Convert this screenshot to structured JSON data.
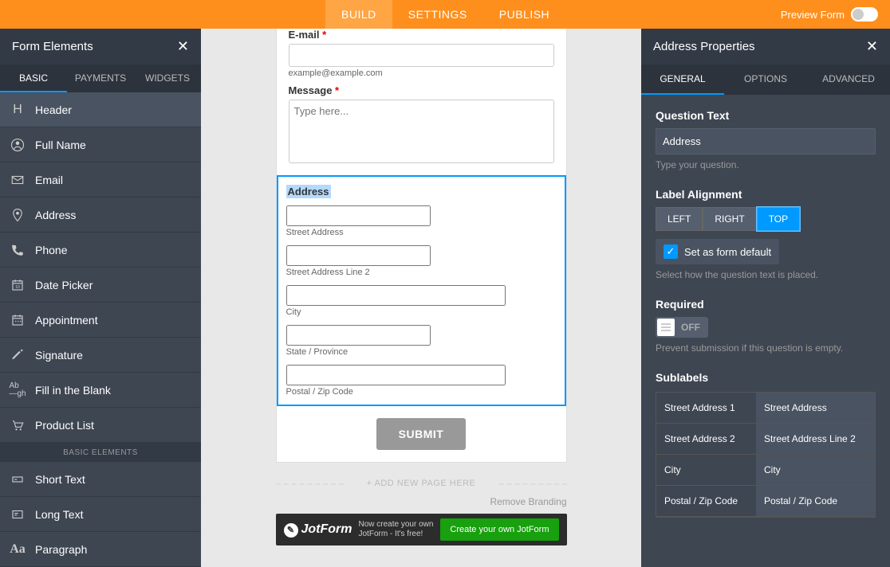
{
  "topbar": {
    "tabs": [
      "BUILD",
      "SETTINGS",
      "PUBLISH"
    ],
    "preview": "Preview Form"
  },
  "left": {
    "title": "Form Elements",
    "tabs": [
      "BASIC",
      "PAYMENTS",
      "WIDGETS"
    ],
    "items": [
      "Header",
      "Full Name",
      "Email",
      "Address",
      "Phone",
      "Date Picker",
      "Appointment",
      "Signature",
      "Fill in the Blank",
      "Product List"
    ],
    "separator": "BASIC ELEMENTS",
    "items2": [
      "Short Text",
      "Long Text",
      "Paragraph"
    ]
  },
  "form": {
    "email_label": "E-mail",
    "email_hint": "example@example.com",
    "message_label": "Message",
    "message_ph": "Type here...",
    "address_label": "Address",
    "addr_fields": [
      "Street Address",
      "Street Address Line 2",
      "City",
      "State / Province",
      "Postal / Zip Code"
    ],
    "submit": "SUBMIT",
    "add_page": "+ ADD NEW PAGE HERE",
    "remove_branding": "Remove Branding",
    "jf_logo": "JotForm",
    "jf_text": "Now create your own JotForm - It's free!",
    "jf_btn": "Create your own JotForm"
  },
  "props": {
    "title": "Address Properties",
    "tabs": [
      "GENERAL",
      "OPTIONS",
      "ADVANCED"
    ],
    "q_title": "Question Text",
    "q_value": "Address",
    "q_hint": "Type your question.",
    "align_title": "Label Alignment",
    "align_opts": [
      "LEFT",
      "RIGHT",
      "TOP"
    ],
    "default_label": "Set as form default",
    "align_hint": "Select how the question text is placed.",
    "req_title": "Required",
    "req_off": "OFF",
    "req_hint": "Prevent submission if this question is empty.",
    "sub_title": "Sublabels",
    "sublabels": [
      {
        "k": "Street Address 1",
        "v": "Street Address"
      },
      {
        "k": "Street Address 2",
        "v": "Street Address Line 2"
      },
      {
        "k": "City",
        "v": "City"
      },
      {
        "k": "Postal / Zip Code",
        "v": "Postal / Zip Code"
      }
    ]
  }
}
